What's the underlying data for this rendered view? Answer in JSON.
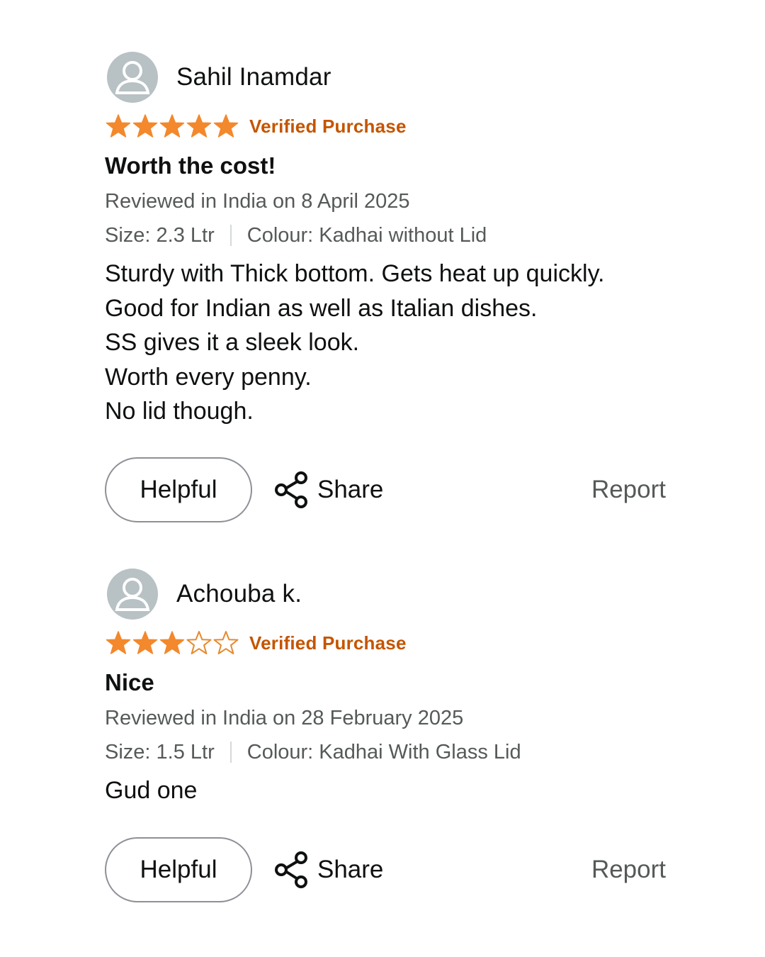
{
  "colors": {
    "star_filled": "#f3882c",
    "star_empty_stroke": "#e68a2e",
    "verified": "#c45500",
    "muted_text": "#565959",
    "avatar_bg": "#b8c1c4"
  },
  "reviews": [
    {
      "author": "Sahil Inamdar",
      "rating": 5,
      "rating_max": 5,
      "badge": "Verified Purchase",
      "title": "Worth the cost!",
      "date": "Reviewed in India on 8 April 2025",
      "size": "Size: 2.3 Ltr",
      "colour": "Colour: Kadhai without Lid",
      "body_lines": [
        "Sturdy with Thick bottom. Gets heat up quickly.",
        "Good for Indian as well as Italian dishes.",
        "SS gives it a sleek look.",
        "Worth every penny.",
        "No lid though."
      ],
      "helpful_label": "Helpful",
      "share_label": "Share",
      "report_label": "Report"
    },
    {
      "author": "Achouba k.",
      "rating": 3,
      "rating_max": 5,
      "badge": "Verified Purchase",
      "title": "Nice",
      "date": "Reviewed in India on 28 February 2025",
      "size": "Size: 1.5 Ltr",
      "colour": "Colour: Kadhai With Glass Lid",
      "body_lines": [
        "Gud one"
      ],
      "helpful_label": "Helpful",
      "share_label": "Share",
      "report_label": "Report"
    }
  ]
}
